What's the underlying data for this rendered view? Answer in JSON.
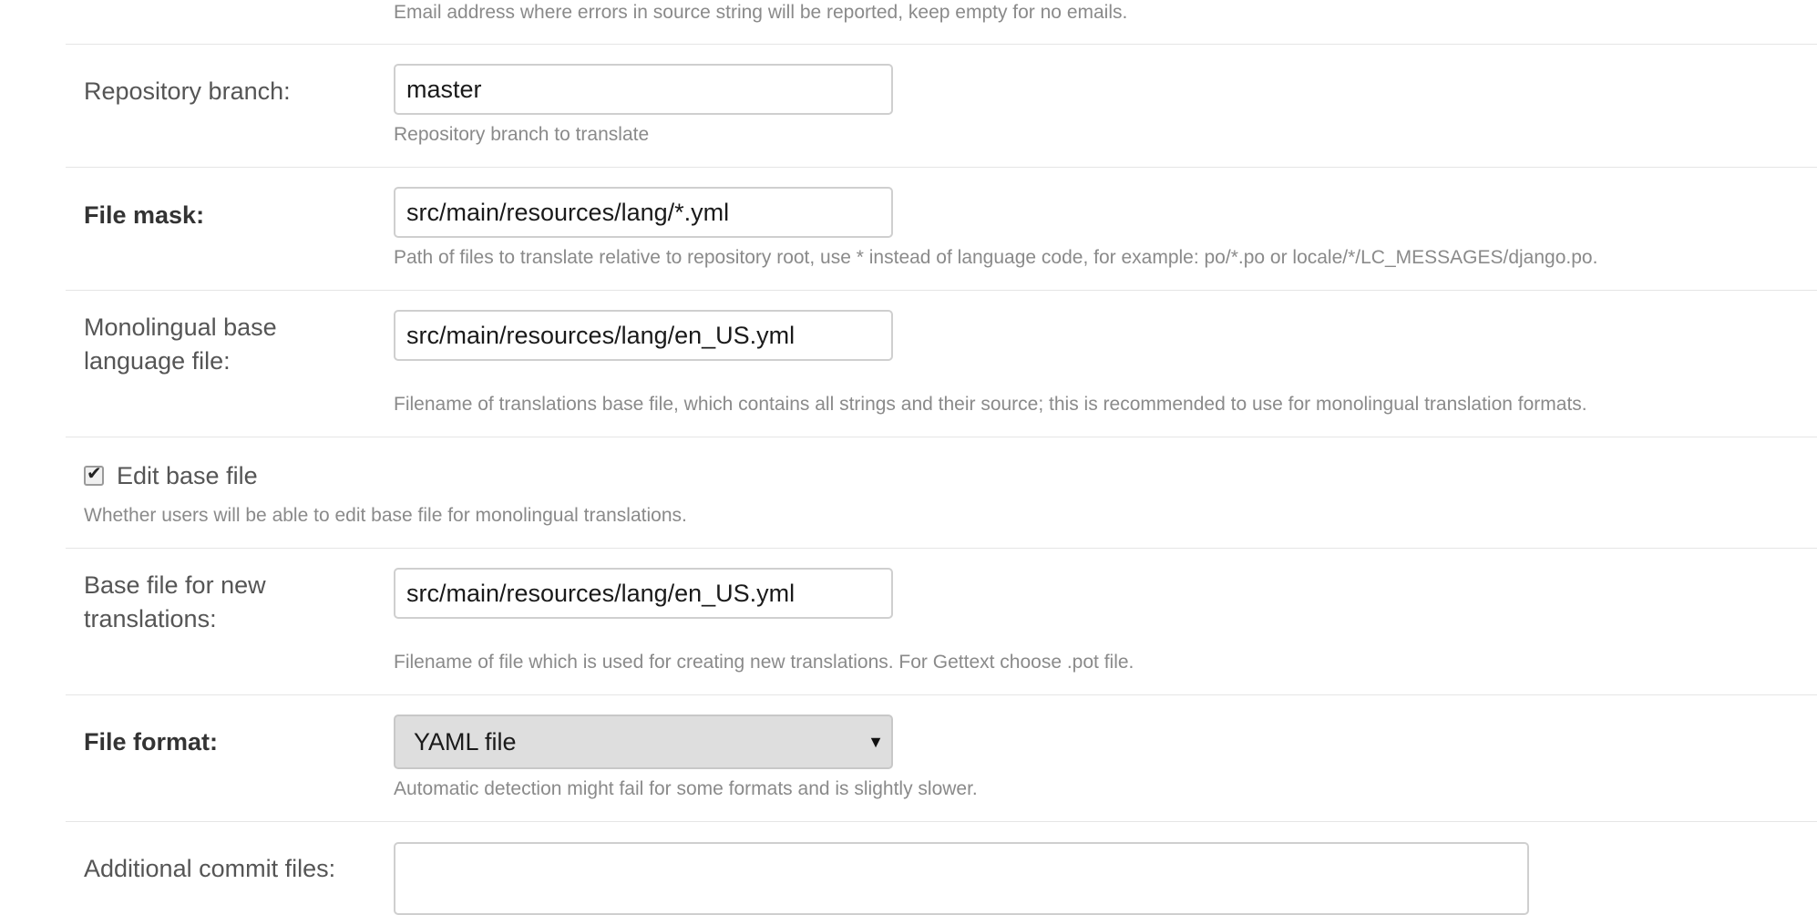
{
  "email": {
    "help": "Email address where errors in source string will be reported, keep empty for no emails."
  },
  "repo_branch": {
    "label": "Repository branch:",
    "value": "master",
    "help": "Repository branch to translate"
  },
  "file_mask": {
    "label": "File mask:",
    "value": "src/main/resources/lang/*.yml",
    "help": "Path of files to translate relative to repository root, use * instead of language code, for example: po/*.po or locale/*/LC_MESSAGES/django.po."
  },
  "mono_base": {
    "label_line1": "Monolingual base",
    "label_line2": "language file:",
    "value": "src/main/resources/lang/en_US.yml",
    "help": "Filename of translations base file, which contains all strings and their source; this is recommended to use for monolingual translation formats."
  },
  "edit_base": {
    "label": "Edit base file",
    "checked": true,
    "help": "Whether users will be able to edit base file for monolingual translations."
  },
  "new_base": {
    "label_line1": "Base file for new",
    "label_line2": "translations:",
    "value": "src/main/resources/lang/en_US.yml",
    "help": "Filename of file which is used for creating new translations. For Gettext choose .pot file."
  },
  "file_format": {
    "label": "File format:",
    "selected": "YAML file",
    "help": "Automatic detection might fail for some formats and is slightly slower."
  },
  "commit_files": {
    "label": "Additional commit files:",
    "value": ""
  }
}
